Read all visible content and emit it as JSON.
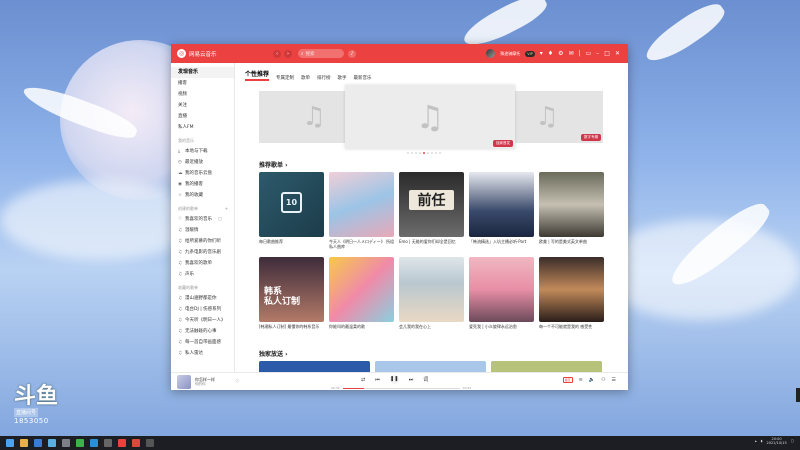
{
  "app": {
    "name": "网易云音乐"
  },
  "header": {
    "search_placeholder": "搜索",
    "username": "殊途骑摩托",
    "vip": "VIP"
  },
  "sidebar": {
    "items": [
      {
        "label": "发现音乐",
        "active": true
      },
      {
        "label": "播客"
      },
      {
        "label": "视频"
      },
      {
        "label": "关注"
      },
      {
        "label": "直播"
      },
      {
        "label": "私人FM"
      }
    ],
    "my_music_header": "我的音乐",
    "my_music": [
      {
        "icon": "download-icon",
        "label": "本地与下载"
      },
      {
        "icon": "clock-icon",
        "label": "最近播放"
      },
      {
        "icon": "cloud-icon",
        "label": "我的音乐云盘"
      },
      {
        "icon": "podcast-icon",
        "label": "我的播客"
      },
      {
        "icon": "star-icon",
        "label": "我的收藏"
      }
    ],
    "created_header": "创建的歌单",
    "created": [
      {
        "icon": "heart-icon",
        "label": "我喜欢的音乐"
      },
      {
        "icon": "note-icon",
        "label": "温暖情"
      },
      {
        "icon": "note-icon",
        "label": "给所爱慕的你们听"
      },
      {
        "icon": "note-icon",
        "label": "九条电影的音乐剧"
      },
      {
        "icon": "note-icon",
        "label": "我喜欢的歌单"
      },
      {
        "icon": "note-icon",
        "label": "声乐"
      }
    ],
    "collected_header": "收藏的歌单",
    "collected": [
      {
        "icon": "note-icon",
        "label": "漫山遍野都是你"
      },
      {
        "icon": "note-icon",
        "label": "电台DJ | 伤感系列"
      },
      {
        "icon": "note-icon",
        "label": "今天听《明日一人》"
      },
      {
        "icon": "note-icon",
        "label": "无法触碰的心事"
      },
      {
        "icon": "note-icon",
        "label": "每一首自带画面感"
      },
      {
        "icon": "note-icon",
        "label": "私人雷达"
      }
    ]
  },
  "tabs": [
    "个性推荐",
    "专属定制",
    "歌单",
    "排行榜",
    "歌手",
    "最新音乐"
  ],
  "banner": {
    "tag_mid": "独家首发",
    "tag_right": "数字专辑"
  },
  "sections": {
    "recommended": "推荐歌单 ›",
    "exclusive": "独家放送 ›"
  },
  "playlists": [
    {
      "caption": "每日歌曲推荐",
      "cover_text": "10"
    },
    {
      "caption": "今天人《明日一人メロディー》 所组私人曲库",
      "cover_text": ""
    },
    {
      "caption": "Emo | 无能的爱你们却全是回忆",
      "cover_text": "前任"
    },
    {
      "caption": "「韩流精选」入坑主播必听·Part",
      "cover_text": ""
    },
    {
      "caption": "欧美 | 写的是美式英文单曲",
      "cover_text": ""
    },
    {
      "caption": "[韩潮私人订制] 最懂你的韩系音乐",
      "cover_text": "韩系\n私人订制"
    },
    {
      "caption": "你能叫的最温柔的歌",
      "cover_text": ""
    },
    {
      "caption": "会儿我的我在心上",
      "cover_text": ""
    },
    {
      "caption": "爱死我 | 小众旋律永远治愈",
      "cover_text": ""
    },
    {
      "caption": "每一个不可能就是我的 感受性",
      "cover_text": ""
    }
  ],
  "player": {
    "song": "你怎样一样",
    "artist": "你的你",
    "time_current": "00:32",
    "time_total": "03:52",
    "progress": 0.18,
    "quality": "极高"
  },
  "overlay": {
    "brand": "斗鱼",
    "sub": "直播间号",
    "room": "1853050"
  },
  "taskbar": {
    "time": "20:00",
    "date": "2021/10/15"
  }
}
